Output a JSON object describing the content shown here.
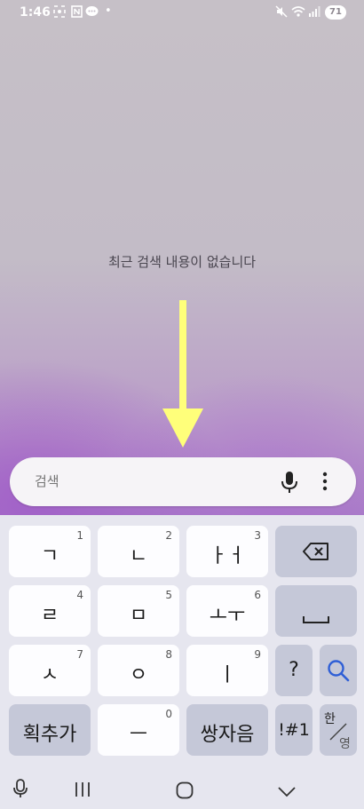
{
  "status_bar": {
    "time": "1:46",
    "battery": "71"
  },
  "empty_message": "최근 검색 내용이 없습니다",
  "search": {
    "placeholder": "검색"
  },
  "keyboard": {
    "row1": [
      {
        "label": "ㄱ",
        "num": "1"
      },
      {
        "label": "ㄴ",
        "num": "2"
      },
      {
        "label": "ㅏㅓ",
        "num": "3"
      }
    ],
    "row2": [
      {
        "label": "ㄹ",
        "num": "4"
      },
      {
        "label": "ㅁ",
        "num": "5"
      },
      {
        "label": "ㅗㅜ",
        "num": "6"
      }
    ],
    "row3": [
      {
        "label": "ㅅ",
        "num": "7"
      },
      {
        "label": "ㅇ",
        "num": "8"
      },
      {
        "label": "ㅣ",
        "num": "9"
      }
    ],
    "question": "?",
    "stroke_add": "획추가",
    "dash": "ㅡ",
    "dash_num": "0",
    "double_consonant": "쌍자음",
    "symbols": "!#1",
    "lang_top": "한",
    "lang_bottom": "영"
  },
  "colors": {
    "accent_search": "#2f5fd6",
    "arrow": "#ffff7a"
  }
}
